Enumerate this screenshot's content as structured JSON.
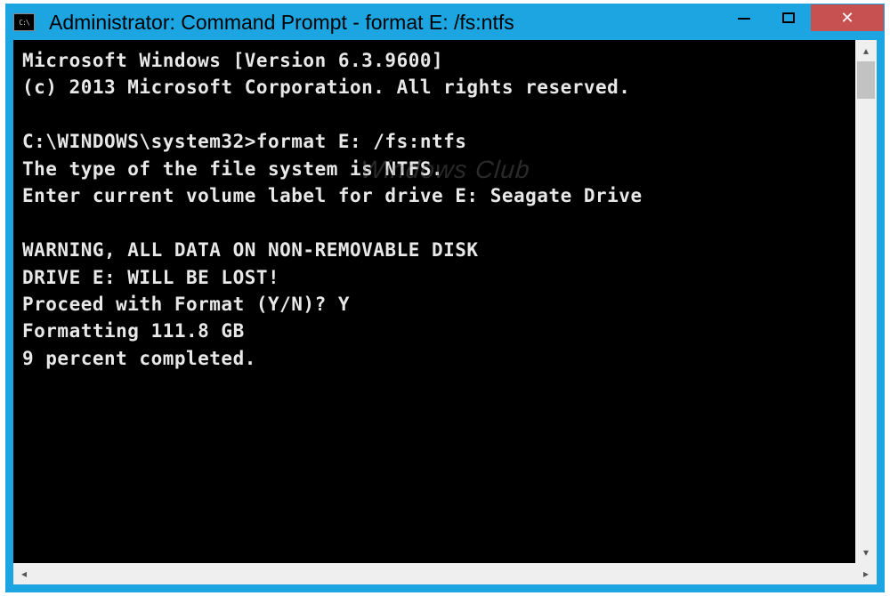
{
  "window": {
    "title": "Administrator: Command Prompt - format  E: /fs:ntfs",
    "icon_label": "C:\\"
  },
  "console": {
    "line1": "Microsoft Windows [Version 6.3.9600]",
    "line2": "(c) 2013 Microsoft Corporation. All rights reserved.",
    "blank1": "",
    "line3": "C:\\WINDOWS\\system32>format E: /fs:ntfs",
    "line4": "The type of the file system is NTFS.",
    "line5": "Enter current volume label for drive E: Seagate Drive",
    "blank2": "",
    "line6": "WARNING, ALL DATA ON NON-REMOVABLE DISK",
    "line7": "DRIVE E: WILL BE LOST!",
    "line8": "Proceed with Format (Y/N)? Y",
    "line9": "Formatting 111.8 GB",
    "line10": "9 percent completed."
  },
  "watermark": "Windows Club"
}
